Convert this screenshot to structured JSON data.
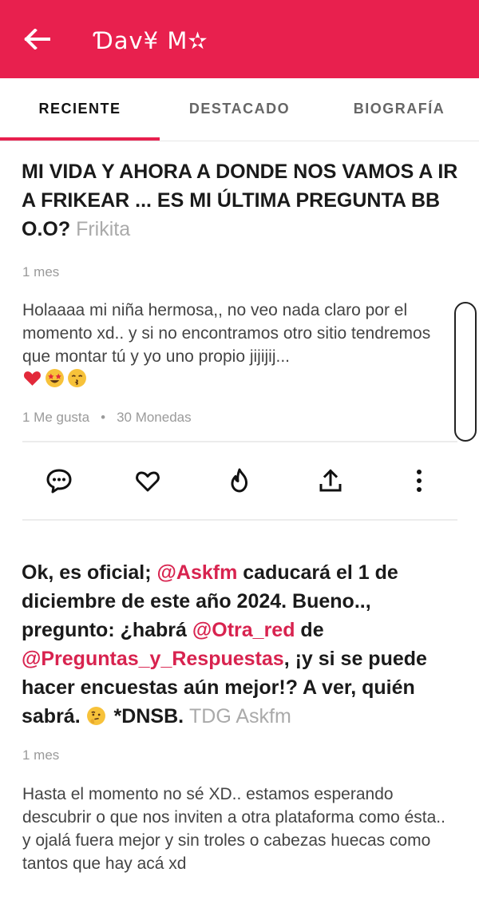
{
  "header": {
    "title": "Ɗav¥ M✫",
    "back_icon": "arrow-left-icon",
    "background": "#e8204e"
  },
  "tabs": [
    {
      "label": "RECIENTE",
      "active": true
    },
    {
      "label": "DESTACADO",
      "active": false
    },
    {
      "label": "BIOGRAFÍA",
      "active": false
    }
  ],
  "posts": [
    {
      "question": "MI VIDA Y AHORA A DONDE NOS VAMOS A IR A FRIKEAR ... ES MI ÚLTIMA PREGUNTA BB  O.O?",
      "author": "Frikita",
      "ago": "1 mes",
      "answer": "Holaaaa mi niña hermosa,, no veo nada claro por el momento xd.. y si no encontramos otro sitio tendremos que montar tú y yo uno propio jijijij...",
      "answer_emojis": [
        "heart-emoji",
        "star-struck-emoji",
        "kissing-emoji"
      ],
      "likes": "1 Me gusta",
      "coins": "30 Monedas",
      "actions": [
        "comment-icon",
        "heart-icon",
        "fire-icon",
        "share-icon",
        "more-vertical-icon"
      ]
    },
    {
      "q_part1": "Ok, es oficial; ",
      "q_mention1": "@Askfm",
      "q_part2": " caducará el 1 de diciembre de este año 2024. Bueno.., pregunto: ¿habrá ",
      "q_mention2": "@Otra_red",
      "q_part3": " de ",
      "q_mention3": "@Preguntas_y_Respuestas",
      "q_part4": ", ¡y si se puede hacer encuestas aún mejor!? A ver, quién sabrá. ",
      "q_emoji": "thinking-emoji",
      "q_part5": " *DNSB.",
      "author": "TDG Askfm",
      "ago": "1 mes",
      "answer": "Hasta el momento no sé XD.. estamos esperando descubrir o que nos inviten a otra plataforma como ésta.. y ojalá fuera mejor y sin troles o cabezas huecas como tantos que hay acá xd"
    }
  ],
  "colors": {
    "accent": "#e8204e",
    "mention": "#d8234f",
    "muted": "#9a9a9a"
  }
}
